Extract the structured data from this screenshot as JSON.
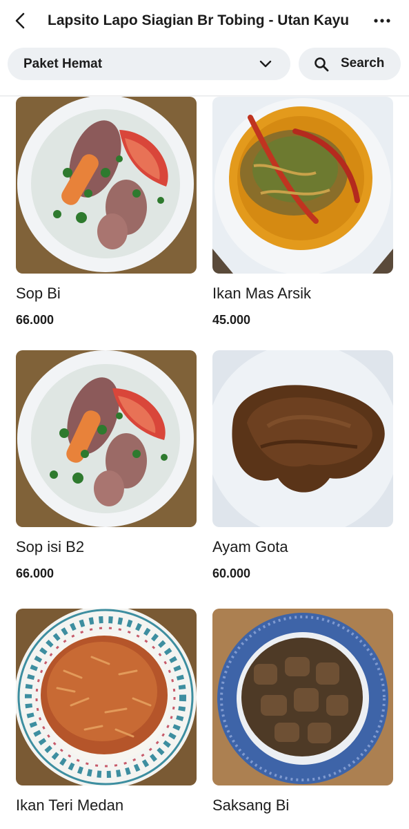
{
  "header": {
    "title": "Lapsito Lapo Siagian Br Tobing - Utan Kayu"
  },
  "filter": {
    "category": "Paket Hemat",
    "search_label": "Search"
  },
  "menu": [
    {
      "name": "Sop Bi",
      "price": "66.000"
    },
    {
      "name": "Ikan Mas Arsik",
      "price": "45.000"
    },
    {
      "name": "Sop isi B2",
      "price": "66.000"
    },
    {
      "name": "Ayam Gota",
      "price": "60.000"
    },
    {
      "name": "Ikan Teri Medan",
      "price": ""
    },
    {
      "name": "Saksang Bi",
      "price": ""
    }
  ],
  "colors": {
    "pill_background": "#edf0f3",
    "text": "#1c1c1c",
    "table_wood": "#8a6a3e",
    "plate_white": "#f2f4f6",
    "plate_blue": "#3e64a8"
  },
  "icons": {
    "back": "chevron-left-icon",
    "more": "more-horizontal-icon",
    "dropdown": "chevron-down-icon",
    "search": "search-icon"
  }
}
